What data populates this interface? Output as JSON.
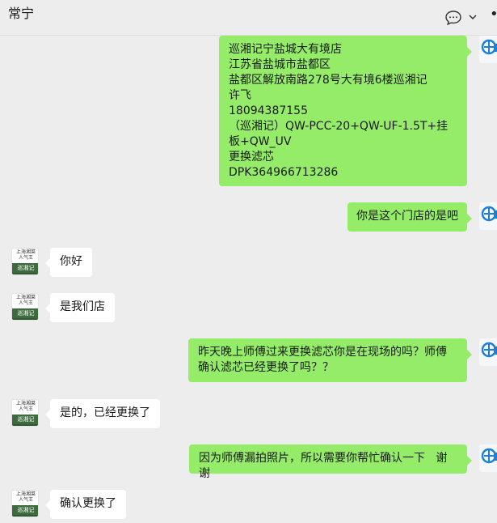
{
  "window": {
    "title": "常宁"
  },
  "avatars": {
    "other": {
      "line1": "上海湘菜",
      "line2": "人气王",
      "brand": "巡湘记"
    }
  },
  "messages": [
    {
      "side": "out",
      "text": "巡湘记宁盐城大有境店\n江苏省盐城市盐都区\n盐都区解放南路278号大有境6楼巡湘记\n许飞\n18094387155\n（巡湘记）QW-PCC-20+QW-UF-1.5T+挂板+QW_UV\n更换滤芯\nDPK364966713286"
    },
    {
      "side": "out",
      "text": "你是这个门店的是吧"
    },
    {
      "side": "in",
      "text": "你好"
    },
    {
      "side": "in",
      "text": "是我们店"
    },
    {
      "side": "out",
      "text": "昨天晚上师傅过来更换滤芯你是在现场的吗？师傅确认滤芯已经更换了吗？？"
    },
    {
      "side": "in",
      "text": "是的，已经更换了"
    },
    {
      "side": "out",
      "text": "因为师傅漏拍照片，所以需要你帮忙确认一下   谢谢"
    },
    {
      "side": "in",
      "text": "确认更换了"
    }
  ],
  "icons": {
    "chat": "chat-bubble-icon",
    "chevron": "chevron-down-icon",
    "more": "more-icon",
    "more_glyph": "•"
  },
  "colors": {
    "outgoing_bubble": "#95ec69",
    "incoming_bubble": "#ffffff",
    "background": "#ededed",
    "avatar_me_blue": "#1d7fd6"
  }
}
